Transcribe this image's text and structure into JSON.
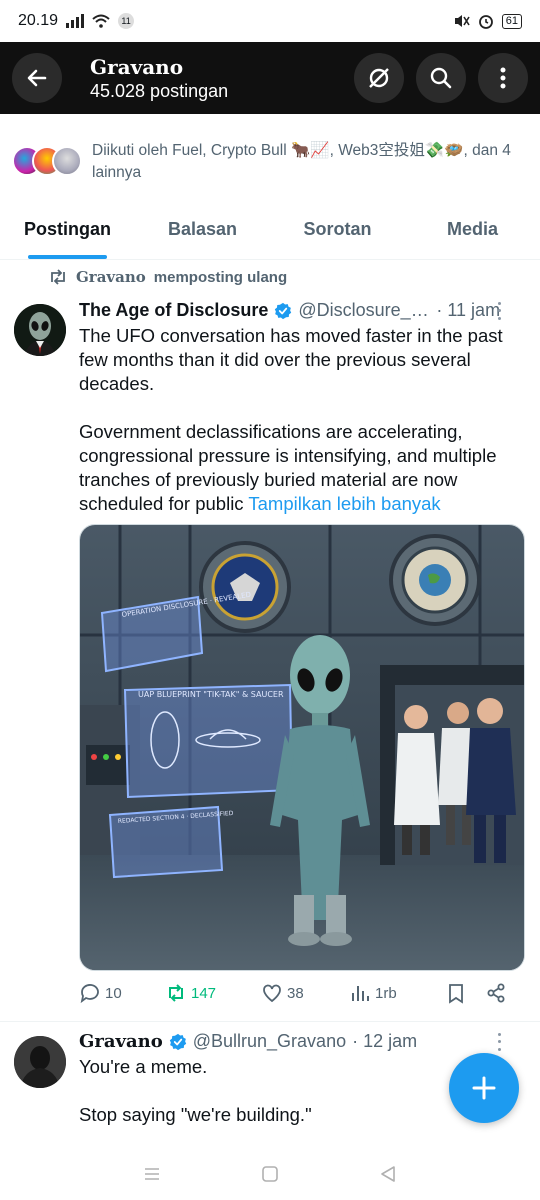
{
  "status_bar": {
    "time": "20.19",
    "notif_count": "11",
    "battery": "61"
  },
  "profile": {
    "name": "Gravano",
    "posts_count": "45.028 postingan"
  },
  "followed_by": {
    "text": "Diikuti oleh Fuel, Crypto Bull 🐂📈, Web3空投姐💸🪺, dan 4 lainnya"
  },
  "tabs": [
    {
      "label": "Postingan",
      "active": true
    },
    {
      "label": "Balasan",
      "active": false
    },
    {
      "label": "Sorotan",
      "active": false
    },
    {
      "label": "Media",
      "active": false
    }
  ],
  "repost": {
    "name": "Gravano",
    "label": "memposting ulang"
  },
  "tweet1": {
    "display_name": "The Age of Disclosure",
    "handle": "@Disclosure_S...",
    "time": "· 11 jam",
    "paragraph1": "The UFO conversation has moved faster in the past few months than it did over the previous several decades.",
    "paragraph2": "Government declassifications are accelerating, congressional pressure is intensifying, and multiple tranches of previously buried material are now scheduled for public",
    "show_more": "Tampilkan lebih banyak",
    "image_labels": {
      "panel_top": "OPERATION DISCLOSURE · REVEALED",
      "panel_mid": "UAP BLUEPRINT \"TIK-TAK\" & SAUCER",
      "panel_bottom": "REDACTED SECTION 4 · DECLASSIFIED"
    },
    "stats": {
      "replies": "10",
      "reposts": "147",
      "likes": "38",
      "views": "1rb"
    }
  },
  "tweet2": {
    "display_name": "Gravano",
    "handle": "@Bullrun_Gravano",
    "time": "· 12 jam",
    "paragraph1": "You're a meme.",
    "paragraph2": "Stop saying \"we're building.\""
  },
  "colors": {
    "accent": "#1d9bf0",
    "repost_green": "#00ba7c",
    "header_bg": "#101010"
  }
}
